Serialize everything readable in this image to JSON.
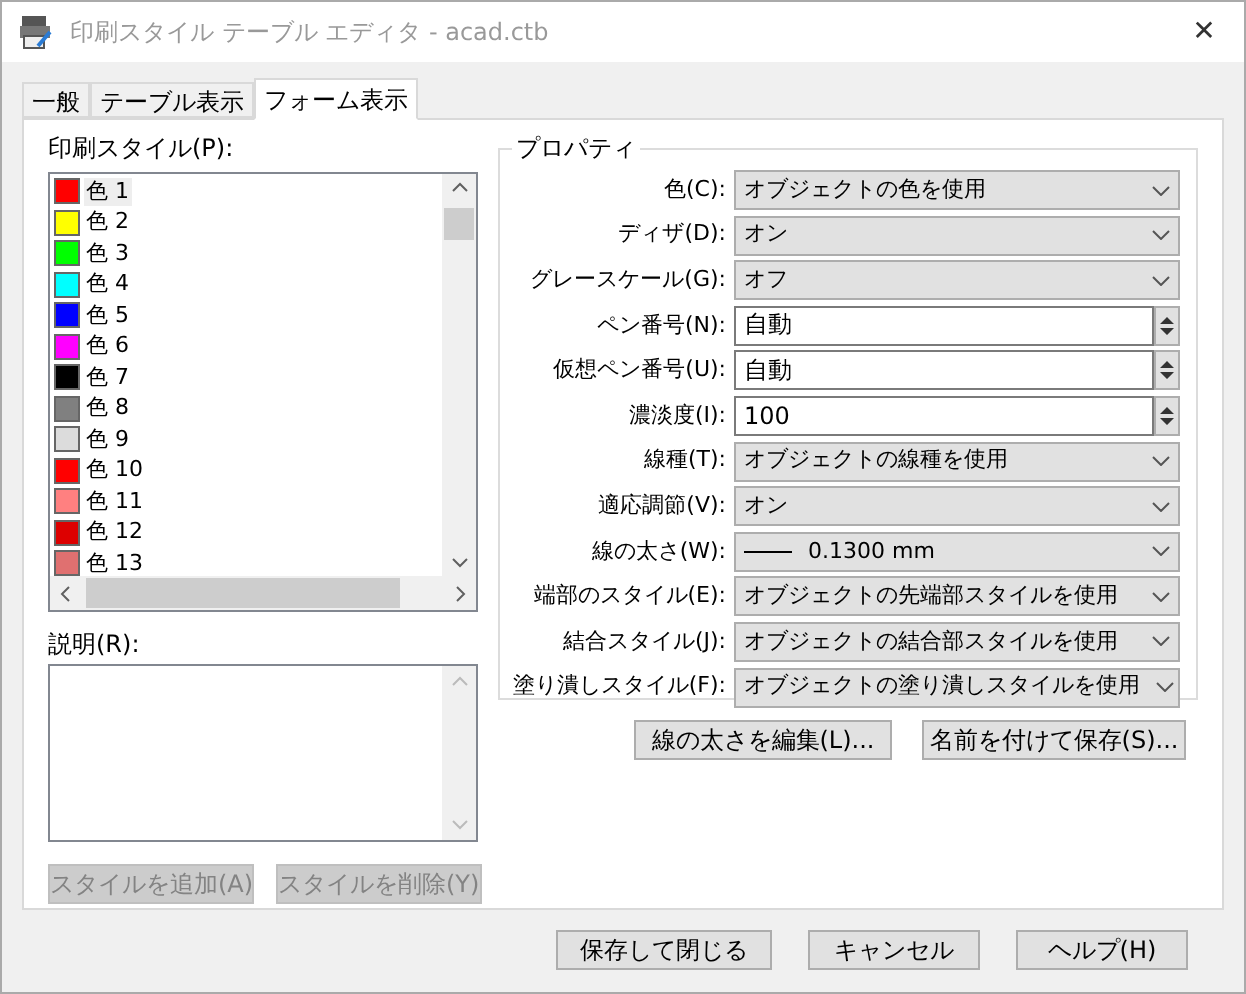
{
  "window": {
    "title": "印刷スタイル テーブル エディタ - acad.ctb",
    "close": "✕"
  },
  "tabs": [
    {
      "label": "一般",
      "selected": false
    },
    {
      "label": "テーブル表示",
      "selected": false
    },
    {
      "label": "フォーム表示",
      "selected": true
    }
  ],
  "styles": {
    "label": "印刷スタイル(P):",
    "items": [
      {
        "label": "色 1",
        "color": "#ff0000",
        "selected": true
      },
      {
        "label": "色 2",
        "color": "#ffff00",
        "selected": false
      },
      {
        "label": "色 3",
        "color": "#00ff00",
        "selected": false
      },
      {
        "label": "色 4",
        "color": "#00ffff",
        "selected": false
      },
      {
        "label": "色 5",
        "color": "#0000ff",
        "selected": false
      },
      {
        "label": "色 6",
        "color": "#ff00ff",
        "selected": false
      },
      {
        "label": "色 7",
        "color": "#000000",
        "selected": false
      },
      {
        "label": "色 8",
        "color": "#808080",
        "selected": false
      },
      {
        "label": "色 9",
        "color": "#dcdcdc",
        "selected": false
      },
      {
        "label": "色 10",
        "color": "#ff0000",
        "selected": false
      },
      {
        "label": "色 11",
        "color": "#ff8080",
        "selected": false
      },
      {
        "label": "色 12",
        "color": "#dd0000",
        "selected": false
      },
      {
        "label": "色 13",
        "color": "#e07070",
        "selected": false
      }
    ]
  },
  "description": {
    "label": "説明(R):"
  },
  "style_buttons": [
    {
      "label": "スタイルを追加(A)",
      "disabled": true
    },
    {
      "label": "スタイルを削除(Y)",
      "disabled": true
    }
  ],
  "properties": {
    "title": "プロパティ",
    "fields": [
      {
        "label": "色(C):",
        "kind": "dropdown",
        "value": "オブジェクトの色を使用"
      },
      {
        "label": "ディザ(D):",
        "kind": "dropdown",
        "value": "オン"
      },
      {
        "label": "グレースケール(G):",
        "kind": "dropdown",
        "value": "オフ"
      },
      {
        "label": "ペン番号(N):",
        "kind": "spinner",
        "value": "自動"
      },
      {
        "label": "仮想ペン番号(U):",
        "kind": "spinner",
        "value": "自動"
      },
      {
        "label": "濃淡度(I):",
        "kind": "spinner",
        "value": "100"
      },
      {
        "label": "線種(T):",
        "kind": "dropdown",
        "value": "オブジェクトの線種を使用"
      },
      {
        "label": "適応調節(V):",
        "kind": "dropdown",
        "value": "オン"
      },
      {
        "label": "線の太さ(W):",
        "kind": "lineweight",
        "value": "0.1300 mm"
      },
      {
        "label": "端部のスタイル(E):",
        "kind": "dropdown",
        "value": "オブジェクトの先端部スタイルを使用"
      },
      {
        "label": "結合スタイル(J):",
        "kind": "dropdown",
        "value": "オブジェクトの結合部スタイルを使用"
      },
      {
        "label": "塗り潰しスタイル(F):",
        "kind": "dropdown",
        "value": "オブジェクトの塗り潰しスタイルを使用"
      }
    ]
  },
  "property_buttons": [
    "線の太さを編集(L)...",
    "名前を付けて保存(S)..."
  ],
  "buttons": [
    "保存して閉じる",
    "キャンセル",
    "ヘルプ(H)"
  ]
}
